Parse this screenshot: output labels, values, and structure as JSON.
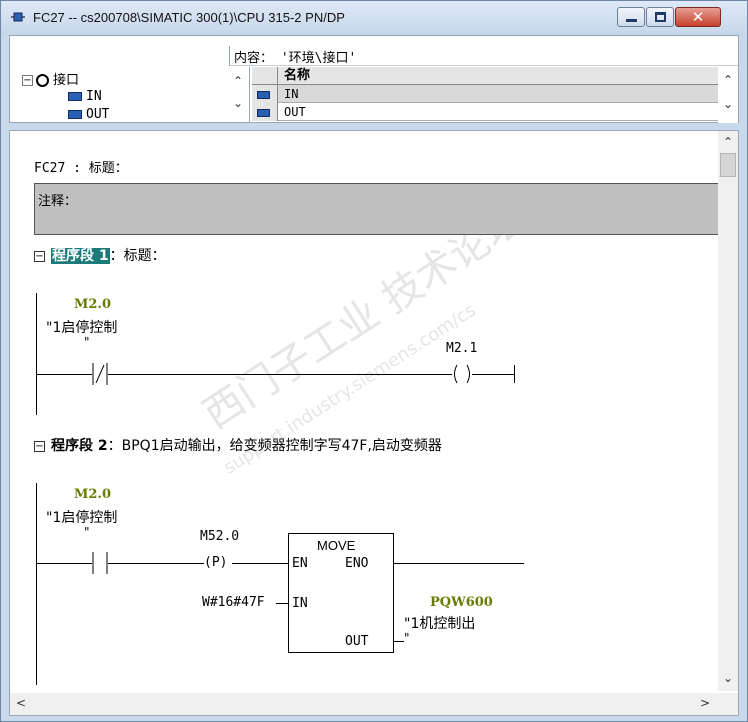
{
  "window": {
    "title": "FC27 -- cs200708\\SIMATIC 300(1)\\CPU 315-2 PN/DP"
  },
  "interface": {
    "content_path": "内容： '环境\\接口'",
    "tree": {
      "root_label": "接口",
      "items": [
        "IN",
        "OUT"
      ]
    },
    "grid": {
      "column_header": "名称",
      "rows": [
        "IN",
        "OUT"
      ]
    }
  },
  "block": {
    "title_line": "FC27 : 标题：",
    "comment_label": "注释："
  },
  "network1": {
    "toggle": "⊟",
    "label": "程序段 1",
    "title_suffix": "：标题：",
    "contact_addr": "M2.0",
    "contact_symbol": "\"1启停控制",
    "contact_symbol_end": "\"",
    "coil_addr": "M2.1"
  },
  "network2": {
    "toggle": "⊟",
    "label": "程序段 2",
    "title_suffix": "：BPQ1启动输出，给变频器控制字写47F,启动变频器",
    "contact_addr": "M2.0",
    "contact_symbol": "\"1启停控制",
    "contact_symbol_end": "\"",
    "edge_addr": "M52.0",
    "edge_label": "(P)",
    "move_title": "MOVE",
    "en": "EN",
    "eno": "ENO",
    "in_pin": "IN",
    "out_pin": "OUT",
    "in_value": "W#16#47F",
    "out_addr": "PQW600",
    "out_symbol": "\"1机控制出",
    "out_symbol_end": "\""
  },
  "watermark": {
    "text1": "西门子工业  技术论坛",
    "text2": "support.industry.siemens.com/cs"
  }
}
